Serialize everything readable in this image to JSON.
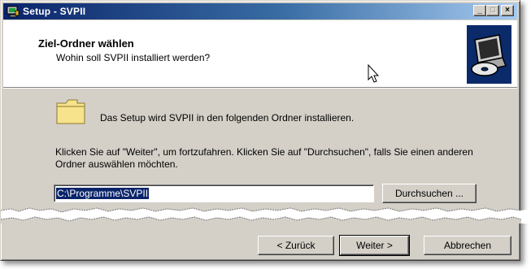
{
  "window": {
    "title": "Setup - SVPII",
    "controls": {
      "minimize": "_",
      "maximize": "□",
      "close": "×"
    }
  },
  "header": {
    "title": "Ziel-Ordner wählen",
    "subtitle": "Wohin soll SVPII installiert werden?",
    "logo_icon": "computer-cd-icon"
  },
  "body": {
    "folder_icon": "folder-icon",
    "folder_text": "Das Setup wird SVPII in den folgenden Ordner installieren.",
    "instructions": "Klicken Sie auf \"Weiter\", um fortzufahren. Klicken Sie auf \"Durchsuchen\", falls Sie einen anderen Ordner auswählen möchten.",
    "path_value": "C:\\Programme\\SVPII",
    "browse_label": "Durchsuchen ..."
  },
  "footer": {
    "back_label": "< Zurück",
    "next_label": "Weiter >",
    "cancel_label": "Abbrechen"
  },
  "colors": {
    "titlebar_start": "#0a246a",
    "titlebar_end": "#a6caf0",
    "dialog_bg": "#d4d0c8",
    "selection": "#0a246a"
  }
}
